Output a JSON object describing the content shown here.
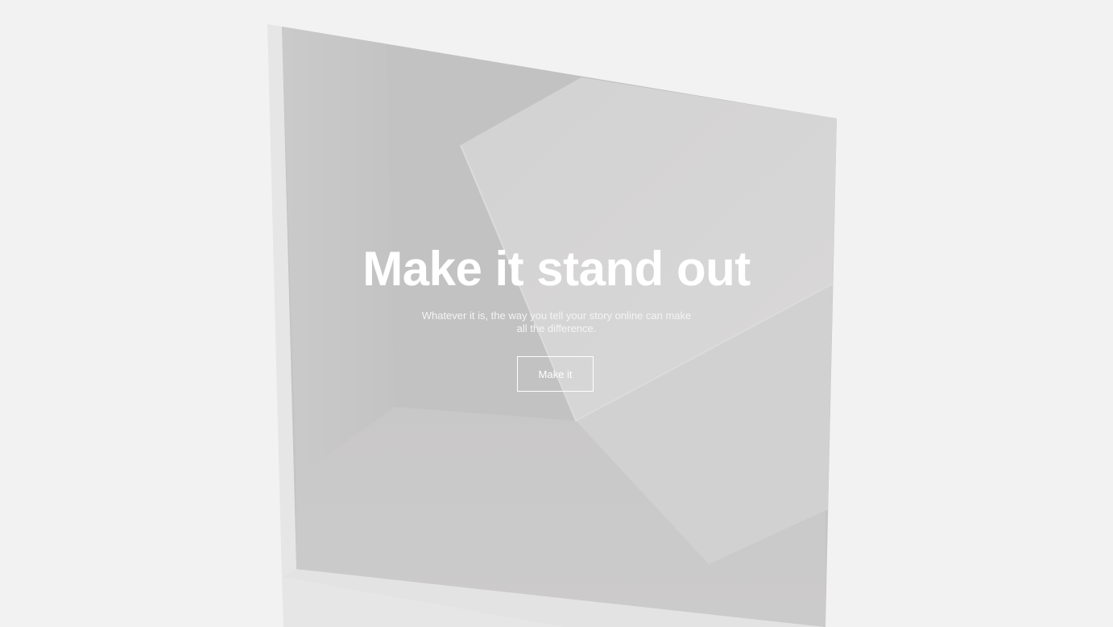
{
  "hero": {
    "headline": "Make it stand out",
    "subline": "Whatever it is, the way you tell your story online can make all the difference.",
    "cta_label": "Make it"
  },
  "colors": {
    "page_background": "#f2f2f2",
    "panel_base": "#c8c7c7",
    "panel_light_facet": "#d6d5d5",
    "text": "#ffffff"
  }
}
